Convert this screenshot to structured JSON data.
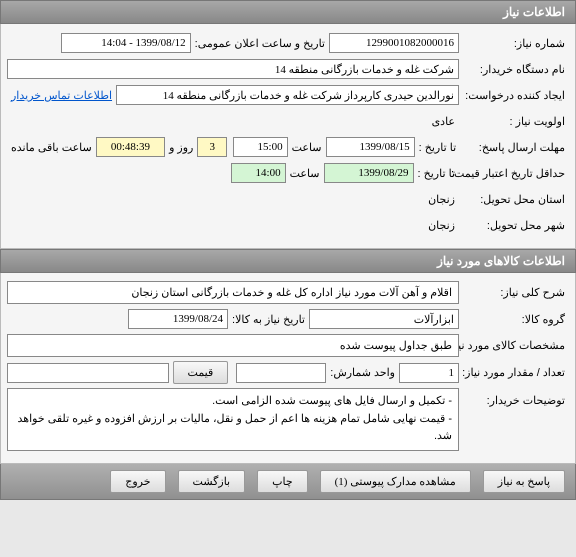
{
  "section1": {
    "title": "اطلاعات نیاز",
    "labels": {
      "reqNo": "شماره نیاز:",
      "announceDateTime": "تاریخ و ساعت اعلان عمومی:",
      "buyerOrg": "نام دستگاه خریدار:",
      "creator": "ایجاد کننده درخواست:",
      "contactLink": "اطلاعات تماس خریدار",
      "priority": "اولویت نیاز :",
      "deadlineSend": "مهلت ارسال پاسخ:",
      "toDate": "تا تاریخ :",
      "time": "ساعت",
      "days": "روز و",
      "remain": "ساعت باقی مانده",
      "validityMin": "حداقل تاریخ اعتبار قیمت:",
      "deliverProvince": "استان محل تحویل:",
      "deliverCity": "شهر محل تحویل:"
    },
    "values": {
      "reqNo": "1299001082000016",
      "announceDateTime": "1399/08/12 - 14:04",
      "buyerOrg": "شرکت غله و خدمات بازرگانی منطقه 14",
      "creator": "نورالدین حیدری کارپرداز شرکت غله و خدمات بازرگانی منطقه 14",
      "priority": "عادی",
      "deadlineDate": "1399/08/15",
      "deadlineTime": "15:00",
      "remainDays": "3",
      "remainClock": "00:48:39",
      "validityDate": "1399/08/29",
      "validityTime": "14:00",
      "province": "زنجان",
      "city": "زنجان"
    }
  },
  "section2": {
    "title": "اطلاعات کالاهای مورد نیاز",
    "labels": {
      "generalDesc": "شرح کلی نیاز:",
      "group": "گروه کالا:",
      "needToDate": "تاریخ نیاز به کالا:",
      "specs": "مشخصات کالای مورد نیاز:",
      "qty": "تعداد / مقدار مورد نیاز:",
      "unit": "واحد شمارش:",
      "priceBtn": "قیمت",
      "buyerNotes": "توضیحات خریدار:"
    },
    "values": {
      "generalDesc": "اقلام و آهن آلات مورد نیاز اداره کل غله و خدمات بازرگانی استان زنجان",
      "group": "ابزارآلات",
      "needToDate": "1399/08/24",
      "specs": "طبق جداول پیوست شده",
      "qty": "1",
      "unit": "",
      "notes_l1": "- تکمیل و ارسال فایل های پیوست شده الزامی است.",
      "notes_l2": "- قیمت نهایی شامل تمام هزینه ها اعم از حمل و نقل، مالیات بر ارزش افزوده و غیره تلقی خواهد شد."
    }
  },
  "footer": {
    "reply": "پاسخ به نیاز",
    "attachments": "مشاهده مدارک پیوستی (1)",
    "print": "چاپ",
    "back": "بازگشت",
    "exit": "خروج"
  }
}
